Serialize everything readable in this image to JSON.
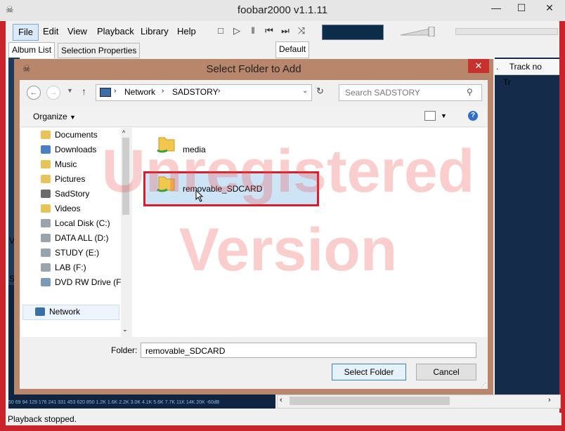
{
  "app": {
    "title": "foobar2000 v1.1.11",
    "menus": [
      "File",
      "Edit",
      "View",
      "Playback",
      "Library",
      "Help"
    ],
    "tabs_left": [
      "Album List",
      "Selection Properties"
    ],
    "tab_default": "Default",
    "column_headers": [
      ".",
      "Track no",
      "Tr"
    ],
    "freq_labels": "50  69  94  129 176 241 331 453 620 850 1.2K 1.6K 2.2K 3.0K 4.1K 5.6K 7.7K 11K 14K 20K",
    "freq_db": "-60dB",
    "status": "Playback stopped.",
    "side_letters": [
      "V",
      "S"
    ]
  },
  "dialog": {
    "title": "Select Folder to Add",
    "breadcrumb": [
      "Network",
      "SADSTORY"
    ],
    "search_placeholder": "Search SADSTORY",
    "organize_label": "Organize",
    "nav_items": [
      {
        "label": "Documents",
        "icon": "documents-icon"
      },
      {
        "label": "Downloads",
        "icon": "downloads-icon"
      },
      {
        "label": "Music",
        "icon": "music-icon"
      },
      {
        "label": "Pictures",
        "icon": "pictures-icon"
      },
      {
        "label": "SadStory",
        "icon": "user-icon"
      },
      {
        "label": "Videos",
        "icon": "videos-icon"
      },
      {
        "label": "Local Disk (C:)",
        "icon": "drive-icon"
      },
      {
        "label": "DATA ALL (D:)",
        "icon": "drive-icon"
      },
      {
        "label": "STUDY (E:)",
        "icon": "drive-icon"
      },
      {
        "label": "LAB (F:)",
        "icon": "drive-icon"
      },
      {
        "label": "DVD RW Drive (F",
        "icon": "dvd-icon"
      }
    ],
    "network_label": "Network",
    "folders": [
      "media",
      "removable_SDCARD"
    ],
    "folder_label": "Folder:",
    "folder_value": "removable_SDCARD",
    "select_button": "Select Folder",
    "cancel_button": "Cancel",
    "watermark_line1": "Unregistered",
    "watermark_line2": "Version"
  },
  "colors": {
    "frame": "#c9242b",
    "dialog_frame": "#b7866b",
    "highlight_border": "#d4202a",
    "selection": "#cde4f7",
    "visualizer": "#0d2b4a"
  }
}
